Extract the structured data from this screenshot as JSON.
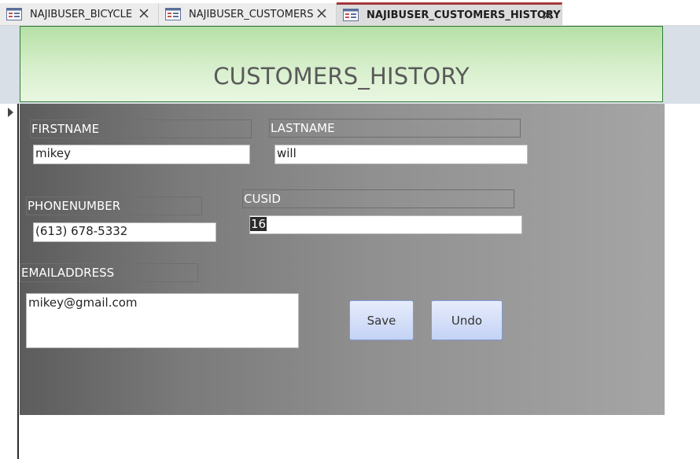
{
  "tabs": [
    {
      "label": "NAJIBUSER_BICYCLE",
      "active": false,
      "icon": "form-icon"
    },
    {
      "label": "NAJIBUSER_CUSTOMERS",
      "active": false,
      "icon": "form-icon"
    },
    {
      "label": "NAJIBUSER_CUSTOMERS_HISTORY",
      "active": true,
      "icon": "form-icon"
    }
  ],
  "header": {
    "title": "CUSTOMERS_HISTORY"
  },
  "form": {
    "firstname": {
      "label": "FIRSTNAME",
      "value": "mikey"
    },
    "lastname": {
      "label": "LASTNAME",
      "value": "will"
    },
    "phonenumber": {
      "label": "PHONENUMBER",
      "value": "(613) 678-5332"
    },
    "cusid": {
      "label": "CUSID",
      "value": "16"
    },
    "emailaddress": {
      "label": "EMAILADDRESS",
      "value": "mikey@gmail.com"
    }
  },
  "buttons": {
    "save": "Save",
    "undo": "Undo"
  },
  "colors": {
    "tab_accent": "#a4373a",
    "header_green": "#b6e0a6",
    "button_blue": "#c4d3f5"
  }
}
